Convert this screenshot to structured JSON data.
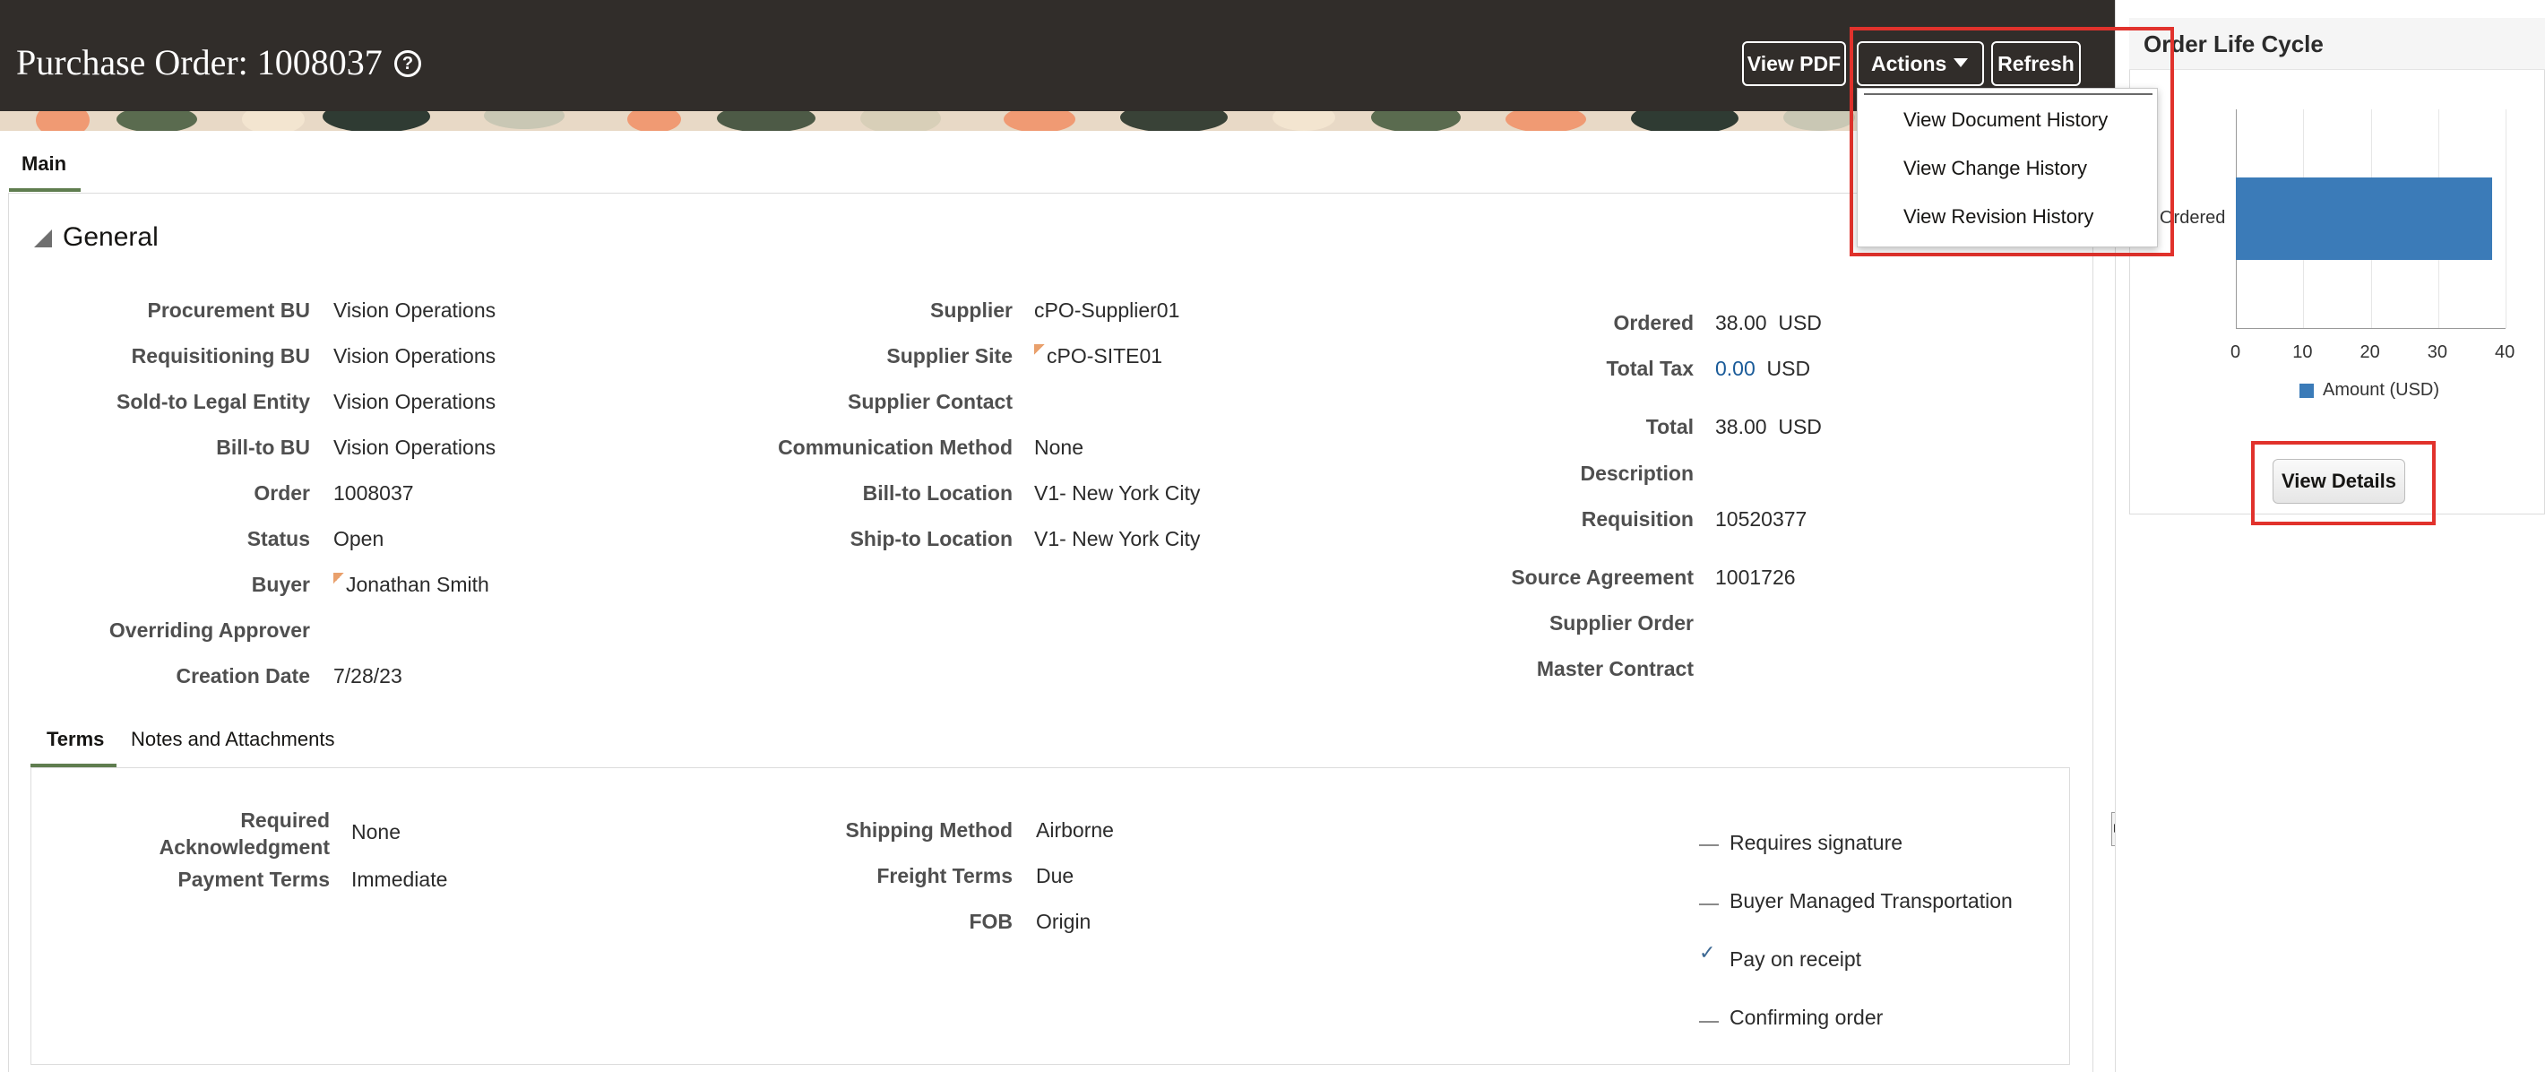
{
  "header": {
    "title": "Purchase Order: 1008037",
    "help_icon": "?",
    "view_pdf_label": "View PDF",
    "actions_label": "Actions",
    "refresh_label": "Refresh"
  },
  "actions_menu": {
    "items": [
      "View Document History",
      "View Change History",
      "View Revision History"
    ]
  },
  "tabs": {
    "main": "Main"
  },
  "general": {
    "title": "General",
    "col1": [
      {
        "label": "Procurement BU",
        "value": "Vision Operations"
      },
      {
        "label": "Requisitioning BU",
        "value": "Vision Operations"
      },
      {
        "label": "Sold-to Legal Entity",
        "value": "Vision Operations"
      },
      {
        "label": "Bill-to BU",
        "value": "Vision Operations"
      },
      {
        "label": "Order",
        "value": "1008037"
      },
      {
        "label": "Status",
        "value": "Open"
      },
      {
        "label": "Buyer",
        "value": "Jonathan Smith"
      },
      {
        "label": "Overriding Approver",
        "value": ""
      },
      {
        "label": "Creation Date",
        "value": "7/28/23"
      }
    ],
    "col2": [
      {
        "label": "Supplier",
        "value": "cPO-Supplier01"
      },
      {
        "label": "Supplier Site",
        "value": "cPO-SITE01"
      },
      {
        "label": "Supplier Contact",
        "value": ""
      },
      {
        "label": "Communication Method",
        "value": "None"
      },
      {
        "label": "Bill-to Location",
        "value": "V1- New York City"
      },
      {
        "label": "Ship-to Location",
        "value": "V1- New York City"
      }
    ],
    "col3": [
      {
        "label": "Ordered",
        "value": "38.00",
        "currency": "USD"
      },
      {
        "label": "Total Tax",
        "value": "0.00",
        "currency": "USD"
      },
      {
        "label": "Total",
        "value": "38.00",
        "currency": "USD"
      },
      {
        "label": "Description",
        "value": ""
      },
      {
        "label": "Requisition",
        "value": "10520377"
      },
      {
        "label": "Source Agreement",
        "value": "1001726"
      },
      {
        "label": "Supplier Order",
        "value": ""
      },
      {
        "label": "Master Contract",
        "value": ""
      }
    ]
  },
  "subtabs": {
    "terms": "Terms",
    "notes": "Notes and Attachments"
  },
  "terms": {
    "col1": [
      {
        "label": "Required\nAcknowledgment",
        "value": "None"
      },
      {
        "label": "Payment Terms",
        "value": "Immediate"
      }
    ],
    "col2": [
      {
        "label": "Shipping Method",
        "value": "Airborne"
      },
      {
        "label": "Freight Terms",
        "value": "Due"
      },
      {
        "label": "FOB",
        "value": "Origin"
      }
    ],
    "flags": [
      {
        "label": "Requires signature",
        "checked": false
      },
      {
        "label": "Buyer Managed Transportation",
        "checked": false
      },
      {
        "label": "Pay on receipt",
        "checked": true
      },
      {
        "label": "Confirming order",
        "checked": false
      }
    ]
  },
  "side_panel": {
    "title": "Order Life Cycle",
    "button_label": "View Details"
  },
  "chart_data": {
    "type": "bar",
    "orientation": "horizontal",
    "categories": [
      "Ordered"
    ],
    "series": [
      {
        "name": "Amount (USD)",
        "values": [
          38
        ]
      }
    ],
    "xlim": [
      0,
      40
    ],
    "xticks": [
      "0",
      "10",
      "20",
      "30",
      "40"
    ],
    "grid": true,
    "legend": "bottom",
    "color": "#3b7bb8"
  },
  "colors": {
    "header_bg": "#312d2a",
    "accent_green": "#5f7d4f",
    "highlight_red": "#e1322c",
    "link_blue": "#1a5b99"
  }
}
